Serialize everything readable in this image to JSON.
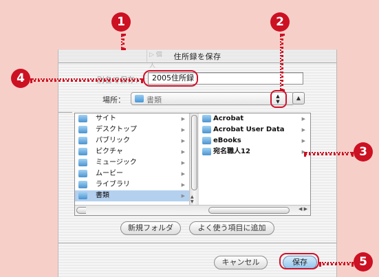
{
  "callouts": [
    "1",
    "2",
    "3",
    "4",
    "5"
  ],
  "dialog": {
    "title": "住所録を保存",
    "ghost_tab": "▷ 個人",
    "save_as_label": "別名で保存：",
    "file_name": "2005住所録",
    "where_label": "場所：",
    "where_value": "書類",
    "collapse_glyph": "▲",
    "stepper_glyph": "▲▼"
  },
  "browser": {
    "column1": [
      {
        "label": "サイト",
        "icon": "folder-icon",
        "selected": false
      },
      {
        "label": "デスクトップ",
        "icon": "desktop-icon",
        "selected": false
      },
      {
        "label": "パブリック",
        "icon": "public-folder-icon",
        "selected": false
      },
      {
        "label": "ピクチャ",
        "icon": "pictures-folder-icon",
        "selected": false
      },
      {
        "label": "ミュージック",
        "icon": "music-folder-icon",
        "selected": false
      },
      {
        "label": "ムービー",
        "icon": "movies-folder-icon",
        "selected": false
      },
      {
        "label": "ライブラリ",
        "icon": "library-folder-icon",
        "selected": false
      },
      {
        "label": "書類",
        "icon": "documents-folder-icon",
        "selected": true
      }
    ],
    "column2": [
      {
        "label": "Acrobat",
        "icon": "folder-icon"
      },
      {
        "label": "Acrobat User Data",
        "icon": "folder-icon"
      },
      {
        "label": "eBooks",
        "icon": "folder-icon"
      },
      {
        "label": "宛名職人12",
        "icon": "folder-icon"
      }
    ],
    "chevron": "▶"
  },
  "buttons": {
    "new_folder": "新規フォルダ",
    "add_favorite": "よく使う項目に追加",
    "cancel": "キャンセル",
    "save": "保存"
  },
  "colors": {
    "background": "#f7cfc9",
    "callout_red": "#cc1122",
    "selection": "#b4d0ef"
  }
}
